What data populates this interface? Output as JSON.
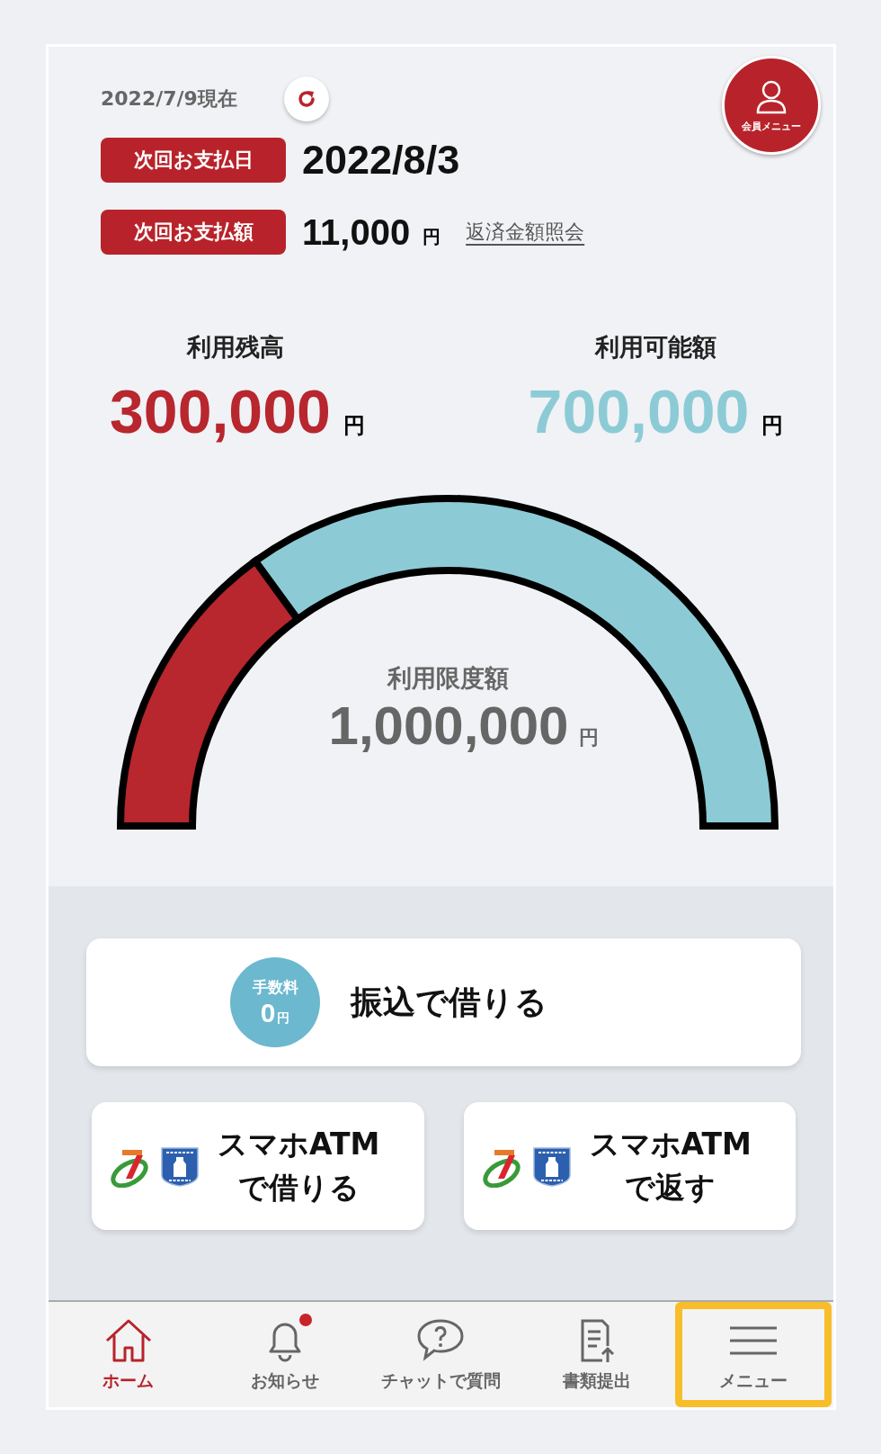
{
  "as_of": "2022/7/9現在",
  "member_menu": {
    "label": "会員メニュー"
  },
  "payment": [
    {
      "label": "次回お支払日",
      "value": "2022/8/3"
    },
    {
      "label": "次回お支払額",
      "value": "11,000",
      "unit": "円",
      "link": "返済金額照会"
    }
  ],
  "balances": [
    {
      "label": "利用残高",
      "amount": "300,000",
      "unit": "円",
      "color": "#b8262e"
    },
    {
      "label": "利用可能額",
      "amount": "700,000",
      "unit": "円",
      "color": "#8ccbd6"
    }
  ],
  "gauge": {
    "label": "利用限度額",
    "amount": "1,000,000",
    "unit": "円"
  },
  "transfer_button": {
    "badge_label": "手数料",
    "badge_amount": "0",
    "badge_unit": "円",
    "label": "振込で借りる"
  },
  "atm_buttons": [
    {
      "line1": "スマホATM",
      "line2": "で借りる"
    },
    {
      "line1": "スマホATM",
      "line2": "で返す"
    }
  ],
  "nav": [
    {
      "kind": "home",
      "label": "ホーム",
      "selected": true,
      "badge": false,
      "highlighted": false
    },
    {
      "kind": "bell",
      "label": "お知らせ",
      "selected": false,
      "badge": true,
      "highlighted": false
    },
    {
      "kind": "chat",
      "label": "チャットで質問",
      "selected": false,
      "badge": false,
      "highlighted": false
    },
    {
      "kind": "document",
      "label": "書類提出",
      "selected": false,
      "badge": false,
      "highlighted": false
    },
    {
      "kind": "menu",
      "label": "メニュー",
      "selected": false,
      "badge": false,
      "highlighted": true
    }
  ]
}
